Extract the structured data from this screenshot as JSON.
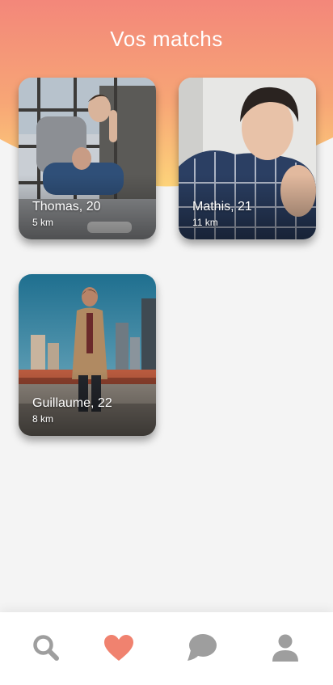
{
  "header": {
    "title": "Vos matchs"
  },
  "colors": {
    "gradient_top": "#f3877a",
    "gradient_bottom": "#fdd37a",
    "icon_inactive": "#9e9e9e",
    "icon_active": "#f0826f"
  },
  "matches": [
    {
      "name": "Thomas, 20",
      "distance": "5 km"
    },
    {
      "name": "Mathis, 21",
      "distance": "11 km"
    },
    {
      "name": "Guillaume, 22",
      "distance": "8 km"
    }
  ],
  "tabbar": {
    "items": [
      {
        "icon": "search-icon",
        "active": false
      },
      {
        "icon": "heart-icon",
        "active": true
      },
      {
        "icon": "chat-icon",
        "active": false
      },
      {
        "icon": "user-icon",
        "active": false
      }
    ]
  }
}
